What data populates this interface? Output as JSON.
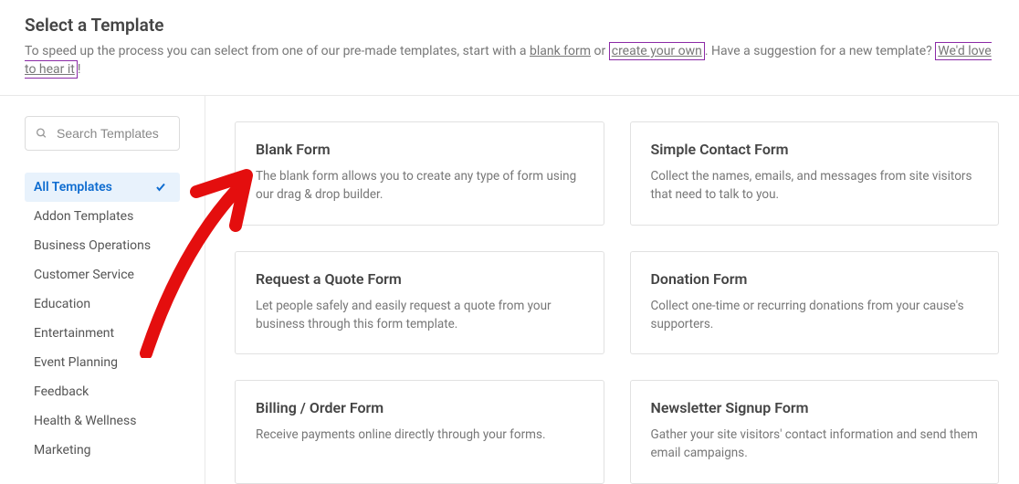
{
  "header": {
    "title": "Select a Template",
    "intro_prefix": "To speed up the process you can select from one of our pre-made templates, start with a ",
    "link_blank_form": "blank form",
    "intro_or": " or ",
    "link_create_own": "create your own",
    "intro_suggestion": ". Have a suggestion for a new template? ",
    "link_feedback": "We'd love to hear it",
    "intro_end": "!"
  },
  "search": {
    "placeholder": "Search Templates"
  },
  "categories": [
    {
      "label": "All Templates",
      "active": true
    },
    {
      "label": "Addon Templates",
      "active": false
    },
    {
      "label": "Business Operations",
      "active": false
    },
    {
      "label": "Customer Service",
      "active": false
    },
    {
      "label": "Education",
      "active": false
    },
    {
      "label": "Entertainment",
      "active": false
    },
    {
      "label": "Event Planning",
      "active": false
    },
    {
      "label": "Feedback",
      "active": false
    },
    {
      "label": "Health & Wellness",
      "active": false
    },
    {
      "label": "Marketing",
      "active": false
    }
  ],
  "templates": [
    {
      "title": "Blank Form",
      "desc": "The blank form allows you to create any type of form using our drag & drop builder."
    },
    {
      "title": "Simple Contact Form",
      "desc": "Collect the names, emails, and messages from site visitors that need to talk to you."
    },
    {
      "title": "Request a Quote Form",
      "desc": "Let people safely and easily request a quote from your business through this form template."
    },
    {
      "title": "Donation Form",
      "desc": "Collect one-time or recurring donations from your cause's supporters."
    },
    {
      "title": "Billing / Order Form",
      "desc": "Receive payments online directly through your forms."
    },
    {
      "title": "Newsletter Signup Form",
      "desc": "Gather your site visitors' contact information and send them email campaigns."
    }
  ]
}
